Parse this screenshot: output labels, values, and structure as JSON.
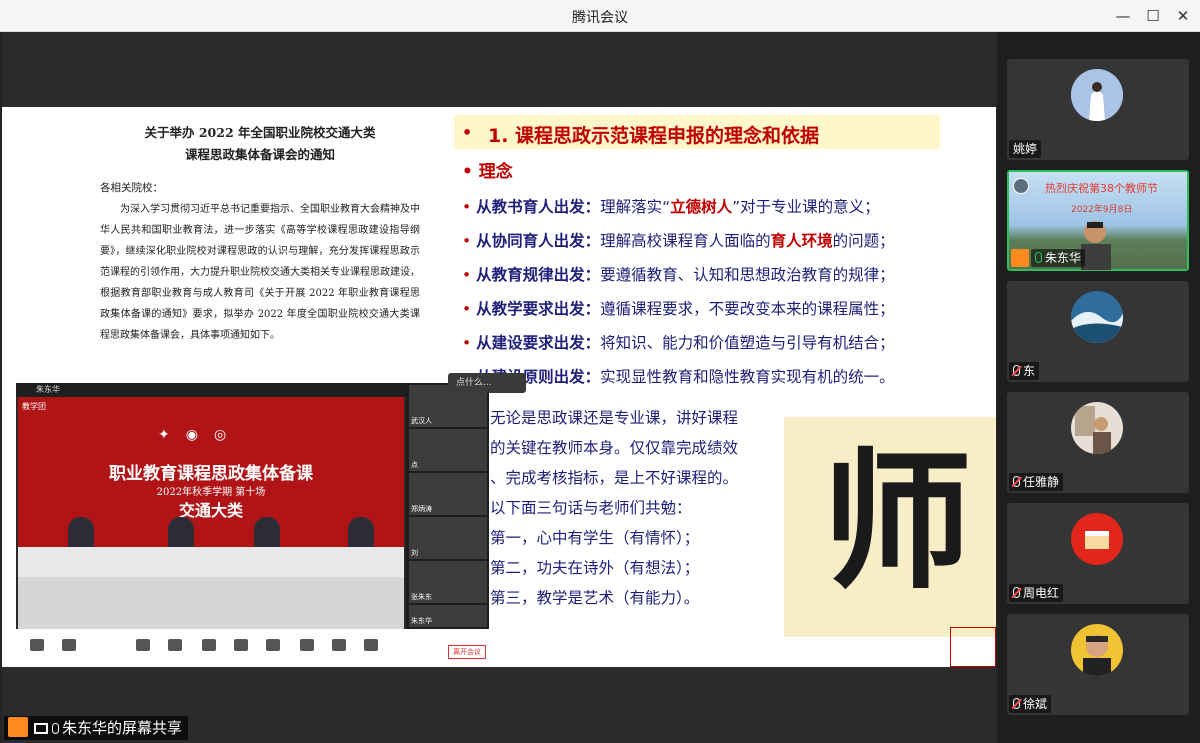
{
  "window": {
    "title": "腾讯会议"
  },
  "doc": {
    "title_line1": "关于举办 2022 年全国职业院校交通大类",
    "title_line2": "课程思政集体备课会的通知",
    "salutation": "各相关院校：",
    "body": "为深入学习贯彻习近平总书记重要指示、全国职业教育大会精神及中华人民共和国职业教育法，进一步落实《高等学校课程思政建设指导纲要》，继续深化职业院校对课程思政的认识与理解，充分发挥课程思政示范课程的引领作用，大力提升职业院校交通大类相关专业课程思政建设，根据教育部职业教育与成人教育司《关于开展 2022 年职业教育课程思政集体备课的通知》要求，拟举办 2022 年度全国职业院校交通大类课程思政集体备课会，具体事项通知如下。"
  },
  "slide": {
    "heading": "1. 课程思政示范课程申报的理念和依据",
    "sub": "理念",
    "points": [
      {
        "k": "从教书育人出发：",
        "a": "理解落实“",
        "hl": "立德树人",
        "b": "”对于专业课的意义；"
      },
      {
        "k": "从协同育人出发：",
        "a": "理解高校课程育人面临的",
        "hl": "育人环境",
        "b": "的问题；"
      },
      {
        "k": "从教育规律出发：",
        "a": "要遵循教育、认知和思想政治教育的规律；",
        "hl": "",
        "b": ""
      },
      {
        "k": "从教学要求出发：",
        "a": "遵循课程要求，不要改变本来的课程属性；",
        "hl": "",
        "b": ""
      },
      {
        "k": "从建设要求出发：",
        "a": "将知识、能力和价值塑造与引导有机结合；",
        "hl": "",
        "b": ""
      },
      {
        "k": "从建设原则出发：",
        "a": "实现显性教育和隐性教育实现有机的统一。",
        "hl": "",
        "b": ""
      }
    ],
    "box_lines": [
      "无论是思政课还是专业课，讲好课程",
      "的关键在教师本身。仅仅靠完成绩效",
      "、完成考核指标，是上不好课程的。",
      "以下面三句话与老师们共勉：",
      "第一，心中有学生（有情怀）；",
      "第二，功夫在诗外（有想法）；",
      "第三，教学是艺术（有能力）。"
    ],
    "calligraphy": "师"
  },
  "inner": {
    "top_label": "朱东华",
    "stage_label": "教学团",
    "banner1": "职业教育课程思政集体备课",
    "banner2": "2022年秋季学期 第十场",
    "banner3": "交通大类",
    "thumbs": [
      "武汉人",
      "点",
      "郑炳涛",
      "刘",
      "张朱东",
      "朱东华",
      "朱"
    ],
    "exit_label": "离开会议",
    "overlay": "点什么..."
  },
  "participants": [
    {
      "name": "姚婷",
      "muted": false
    },
    {
      "name": "朱东华",
      "muted": false,
      "active": true,
      "live_title": "热烈庆祝第38个教师节",
      "live_date": "2022年9月8日"
    },
    {
      "name": "东",
      "muted": true
    },
    {
      "name": "任雅静",
      "muted": true
    },
    {
      "name": "周电红",
      "muted": true
    },
    {
      "name": "徐斌",
      "muted": true
    }
  ],
  "share_label": "朱东华的屏幕共享"
}
